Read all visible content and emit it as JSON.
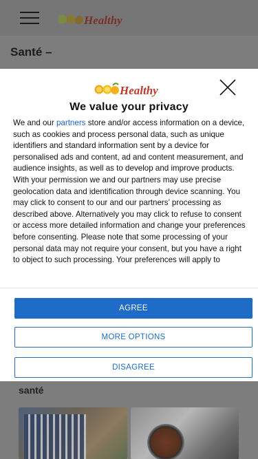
{
  "header": {
    "logo_text": "Healthy",
    "logo_letters": "Soo"
  },
  "page": {
    "title": "Santé –",
    "section_label": "santé"
  },
  "consent": {
    "logo_text": "Healthy",
    "logo_letters": "Soo",
    "heading": "We value your privacy",
    "body_before_link": "We and our ",
    "body_link": "partners",
    "body_after_link": " store and/or access information on a device, such as cookies and process personal data, such as unique identifiers and standard information sent by a device for personalised ads and content, ad and content measurement, and audience insights, as well as to develop and improve products. With your permission we and our partners may use precise geolocation data and identification through device scanning. You may click to consent to our and our partners’ processing as described above. Alternatively you may click to refuse to consent or access more detailed information and change your preferences before consenting. Please note that some processing of your personal data may not require your consent, but you have a right to object to such processing. Your preferences will apply to",
    "buttons": {
      "agree": "AGREE",
      "more_options": "MORE OPTIONS",
      "disagree": "DISAGREE"
    }
  },
  "colors": {
    "accent": "#1e6cc8",
    "logo_green": "#5aa02c",
    "logo_red": "#c0392b",
    "logo_orange": "#f0a81e"
  }
}
